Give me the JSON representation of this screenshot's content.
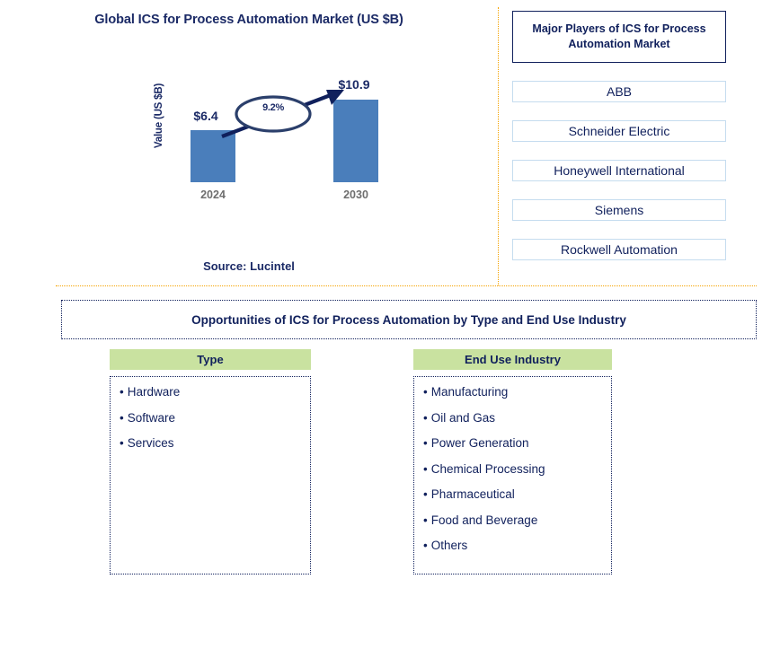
{
  "chart_data": {
    "type": "bar",
    "title": "Global ICS for Process Automation Market (US $B)",
    "xlabel": "",
    "ylabel": "Value (US $B)",
    "categories": [
      "2024",
      "2030"
    ],
    "values": [
      6.4,
      10.9
    ],
    "value_labels": [
      "$6.4",
      "$10.9"
    ],
    "ylim": [
      0,
      12
    ],
    "grid": false,
    "legend": false,
    "bar_color": "#4a7ebb",
    "annotations": [
      {
        "type": "cagr-ellipse-arrow",
        "label": "9.2%",
        "from_category": "2024",
        "to_category": "2030"
      }
    ],
    "source": "Source: Lucintel"
  },
  "header": {
    "title": "Global ICS for Process Automation Market (US $B)"
  },
  "chart": {
    "y_axis_label": "Value (US $B)",
    "cagr_label": "9.2%",
    "bars": [
      {
        "category": "2024",
        "value_label": "$6.4"
      },
      {
        "category": "2030",
        "value_label": "$10.9"
      }
    ],
    "source": "Source: Lucintel"
  },
  "players_panel": {
    "header": "Major Players of ICS for Process Automation Market",
    "items": [
      {
        "label": "ABB"
      },
      {
        "label": "Schneider Electric"
      },
      {
        "label": "Honeywell International"
      },
      {
        "label": "Siemens"
      },
      {
        "label": "Rockwell Automation"
      }
    ]
  },
  "opportunities": {
    "title": "Opportunities of ICS for Process Automation by Type and End Use Industry",
    "columns": [
      {
        "header": "Type",
        "items": [
          {
            "label": "Hardware"
          },
          {
            "label": "Software"
          },
          {
            "label": "Services"
          }
        ]
      },
      {
        "header": "End Use Industry",
        "items": [
          {
            "label": "Manufacturing"
          },
          {
            "label": "Oil and Gas"
          },
          {
            "label": "Power Generation"
          },
          {
            "label": "Chemical Processing"
          },
          {
            "label": "Pharmaceutical"
          },
          {
            "label": "Food and Beverage"
          },
          {
            "label": "Others"
          }
        ]
      }
    ]
  },
  "colors": {
    "bar": "#4a7ebb",
    "navy": "#10205c",
    "title_navy": "#1b2a66",
    "divider_orange": "#f5a300",
    "header_green": "#c9e2a0",
    "player_border": "#c5dcef",
    "category_gray": "#6e6e6e"
  },
  "bullet": "•"
}
